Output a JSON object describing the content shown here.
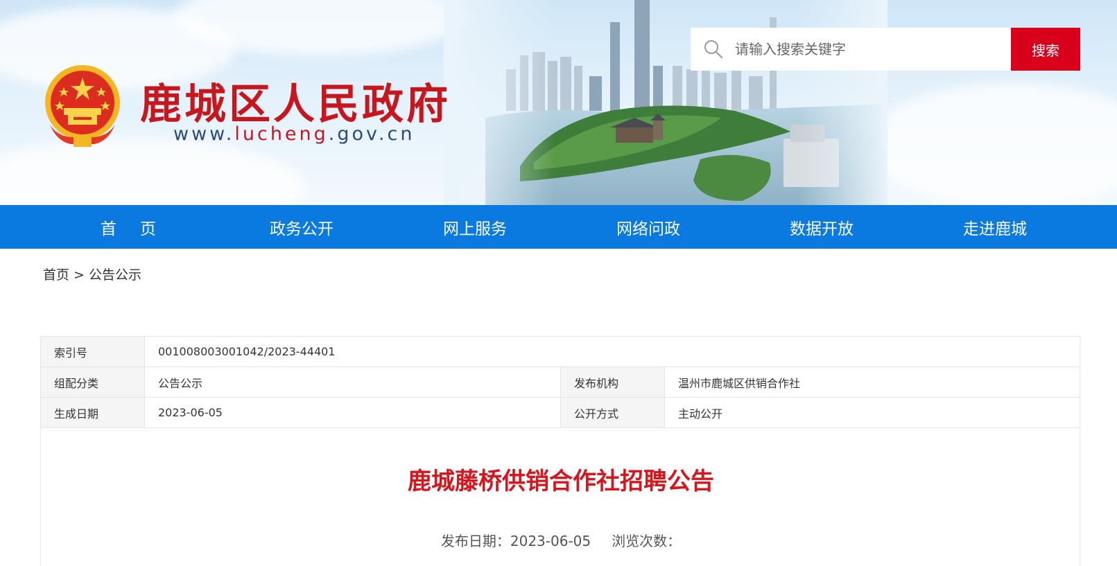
{
  "header": {
    "site_title": "鹿城区人民政府",
    "site_url_prefix": "www.",
    "site_url_highlight": "lucheng",
    "site_url_suffix": ".gov.cn",
    "logo_icon": "national-emblem-icon"
  },
  "search": {
    "placeholder": "请输入搜索关键字",
    "button_label": "搜索",
    "icon": "search-icon"
  },
  "nav": {
    "items": [
      {
        "label": "首页"
      },
      {
        "label": "政务公开"
      },
      {
        "label": "网上服务"
      },
      {
        "label": "网络问政"
      },
      {
        "label": "数据开放"
      },
      {
        "label": "走进鹿城"
      }
    ]
  },
  "breadcrumb": {
    "home": "首页",
    "separator": ">",
    "current": "公告公示"
  },
  "meta": {
    "index_label": "索引号",
    "index_value": "001008003001042/2023-44401",
    "category_label": "组配分类",
    "category_value": "公告公示",
    "publisher_label": "发布机构",
    "publisher_value": "温州市鹿城区供销合作社",
    "created_label": "生成日期",
    "created_value": "2023-06-05",
    "disclosure_label": "公开方式",
    "disclosure_value": "主动公开"
  },
  "article": {
    "title": "鹿城藤桥供销合作社招聘公告",
    "publish_label": "发布日期：",
    "publish_date": "2023-06-05",
    "views_label": "浏览次数："
  },
  "colors": {
    "brand_red": "#c8161d",
    "nav_blue": "#0a7ae0",
    "search_red": "#d9001b",
    "title_red": "#d9141b"
  }
}
